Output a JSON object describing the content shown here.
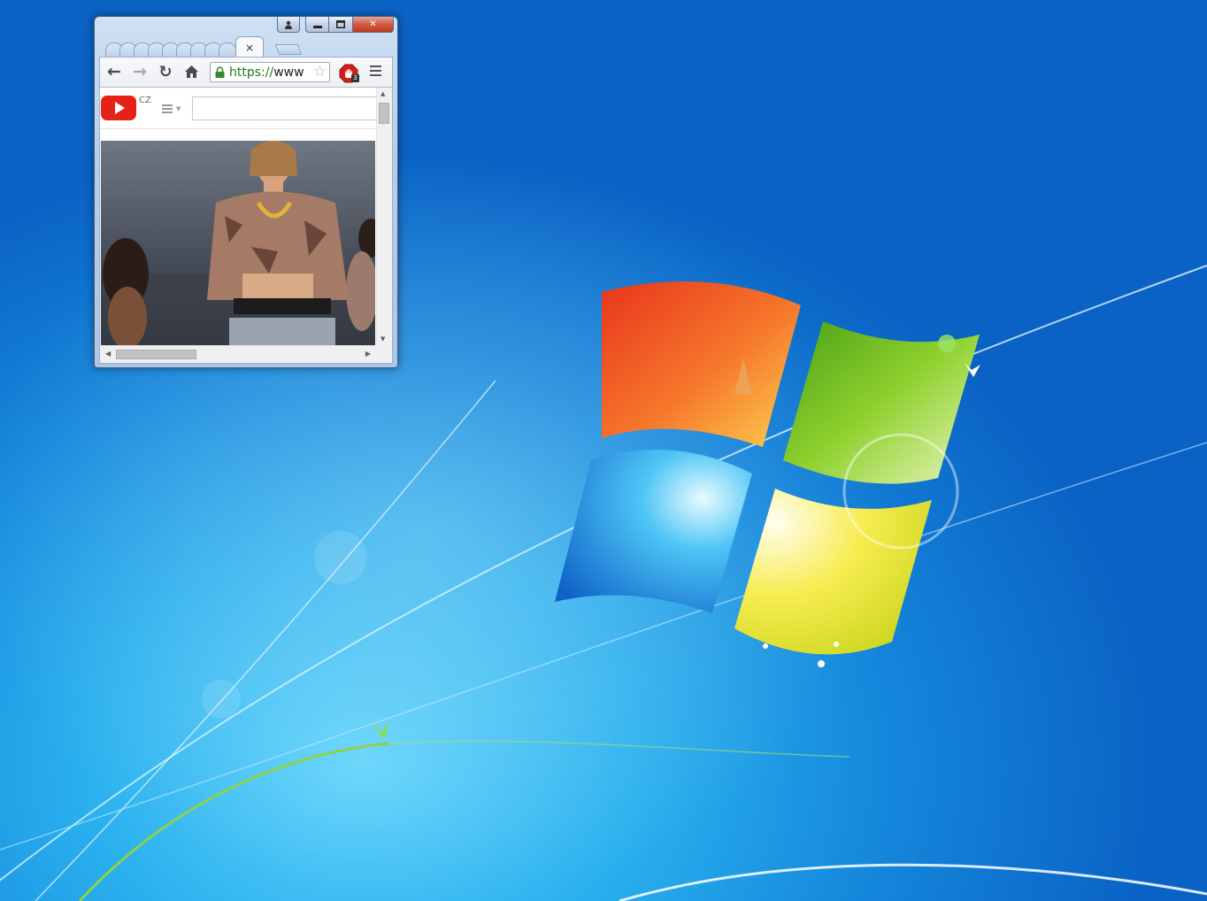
{
  "desktop": {
    "wallpaper": "Windows 7 default wallpaper",
    "colors": {
      "sky_light": "#5fd3fb",
      "sky_mid": "#1588dc",
      "sky_dark": "#0a62c4"
    },
    "logo_colors": [
      "#f05a24",
      "#7dbf1e",
      "#1a8fe0",
      "#f6d313"
    ]
  },
  "window": {
    "caption_buttons": {
      "profile_icon": "person-icon",
      "minimize_icon": "minimize-icon",
      "maximize_icon": "restore-icon",
      "close_label": "✕"
    },
    "tabs": {
      "active_close_label": "×",
      "new_tab_icon": "new-tab-icon"
    }
  },
  "toolbar": {
    "back_icon": "←",
    "forward_icon": "→",
    "reload_icon": "↻",
    "home_icon": "home-icon",
    "omnibox": {
      "scheme": "https://",
      "host": "www",
      "secure_color": "#1f7a1f",
      "star_icon": "☆"
    },
    "extension": {
      "icon": "stop-hand-icon",
      "badge": "3"
    },
    "menu_icon": "hamburger-menu-icon"
  },
  "page": {
    "youtube": {
      "country_code": "CZ",
      "search_placeholder": "",
      "brand_color": "#e62117"
    },
    "video": {
      "description": "music video frame"
    }
  },
  "scrollbars": {
    "up_arrow": "▲",
    "down_arrow": "▼",
    "left_arrow": "◀",
    "right_arrow": "▶"
  }
}
